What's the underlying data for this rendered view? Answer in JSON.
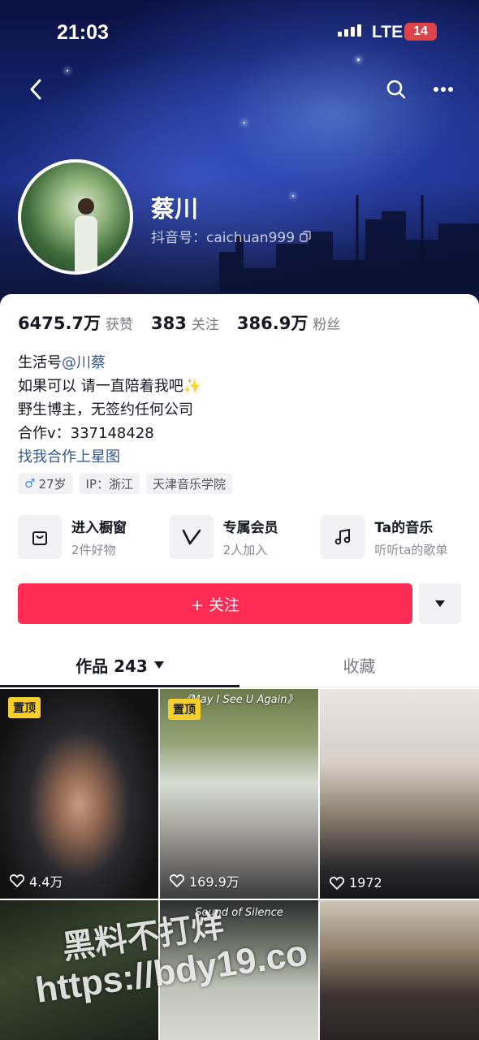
{
  "status_bar": {
    "time": "21:03",
    "network": "LTE",
    "battery": "14"
  },
  "profile": {
    "nickname": "蔡川",
    "douyin_id": "抖音号：caichuan999"
  },
  "stats": [
    {
      "value": "6475.7万",
      "label": "获赞"
    },
    {
      "value": "383",
      "label": "关注"
    },
    {
      "value": "386.9万",
      "label": "粉丝"
    }
  ],
  "bio": {
    "life_prefix": "生活号",
    "life_link": "@川蔡",
    "line2": "如果可以 请一直陪着我吧✨",
    "line3": "野生博主，无签约任何公司",
    "line4": "合作v：337148428",
    "link_line": "找我合作上星图"
  },
  "tags": {
    "age": "27岁",
    "ip": "IP：浙江",
    "school": "天津音乐学院"
  },
  "shortcuts": [
    {
      "title": "进入橱窗",
      "sub": "2件好物",
      "icon": "shopping-bag-icon"
    },
    {
      "title": "专属会员",
      "sub": "2人加入",
      "icon": "vip-v-icon"
    },
    {
      "title": "Ta的音乐",
      "sub": "听听ta的歌单",
      "icon": "music-note-icon"
    }
  ],
  "follow_button": "+ 关注",
  "tabs": {
    "works": "作品 243",
    "favorites": "收藏"
  },
  "grid": [
    {
      "pinned": "置顶",
      "likes": "4.4万",
      "title": ""
    },
    {
      "pinned": "置顶",
      "likes": "169.9万",
      "title": "《May I See U Again》"
    },
    {
      "pinned": "",
      "likes": "1972",
      "title": ""
    },
    {
      "pinned": "",
      "likes": "",
      "title": ""
    },
    {
      "pinned": "",
      "likes": "",
      "title": "Sound of Silence"
    },
    {
      "pinned": "",
      "likes": "",
      "title": ""
    }
  ],
  "watermark": {
    "line1": "黑料不打烊",
    "line2": "https://bdy19.co"
  },
  "colors": {
    "accent": "#fe2c55",
    "link": "#35578f",
    "pin": "#f7cf2a"
  }
}
